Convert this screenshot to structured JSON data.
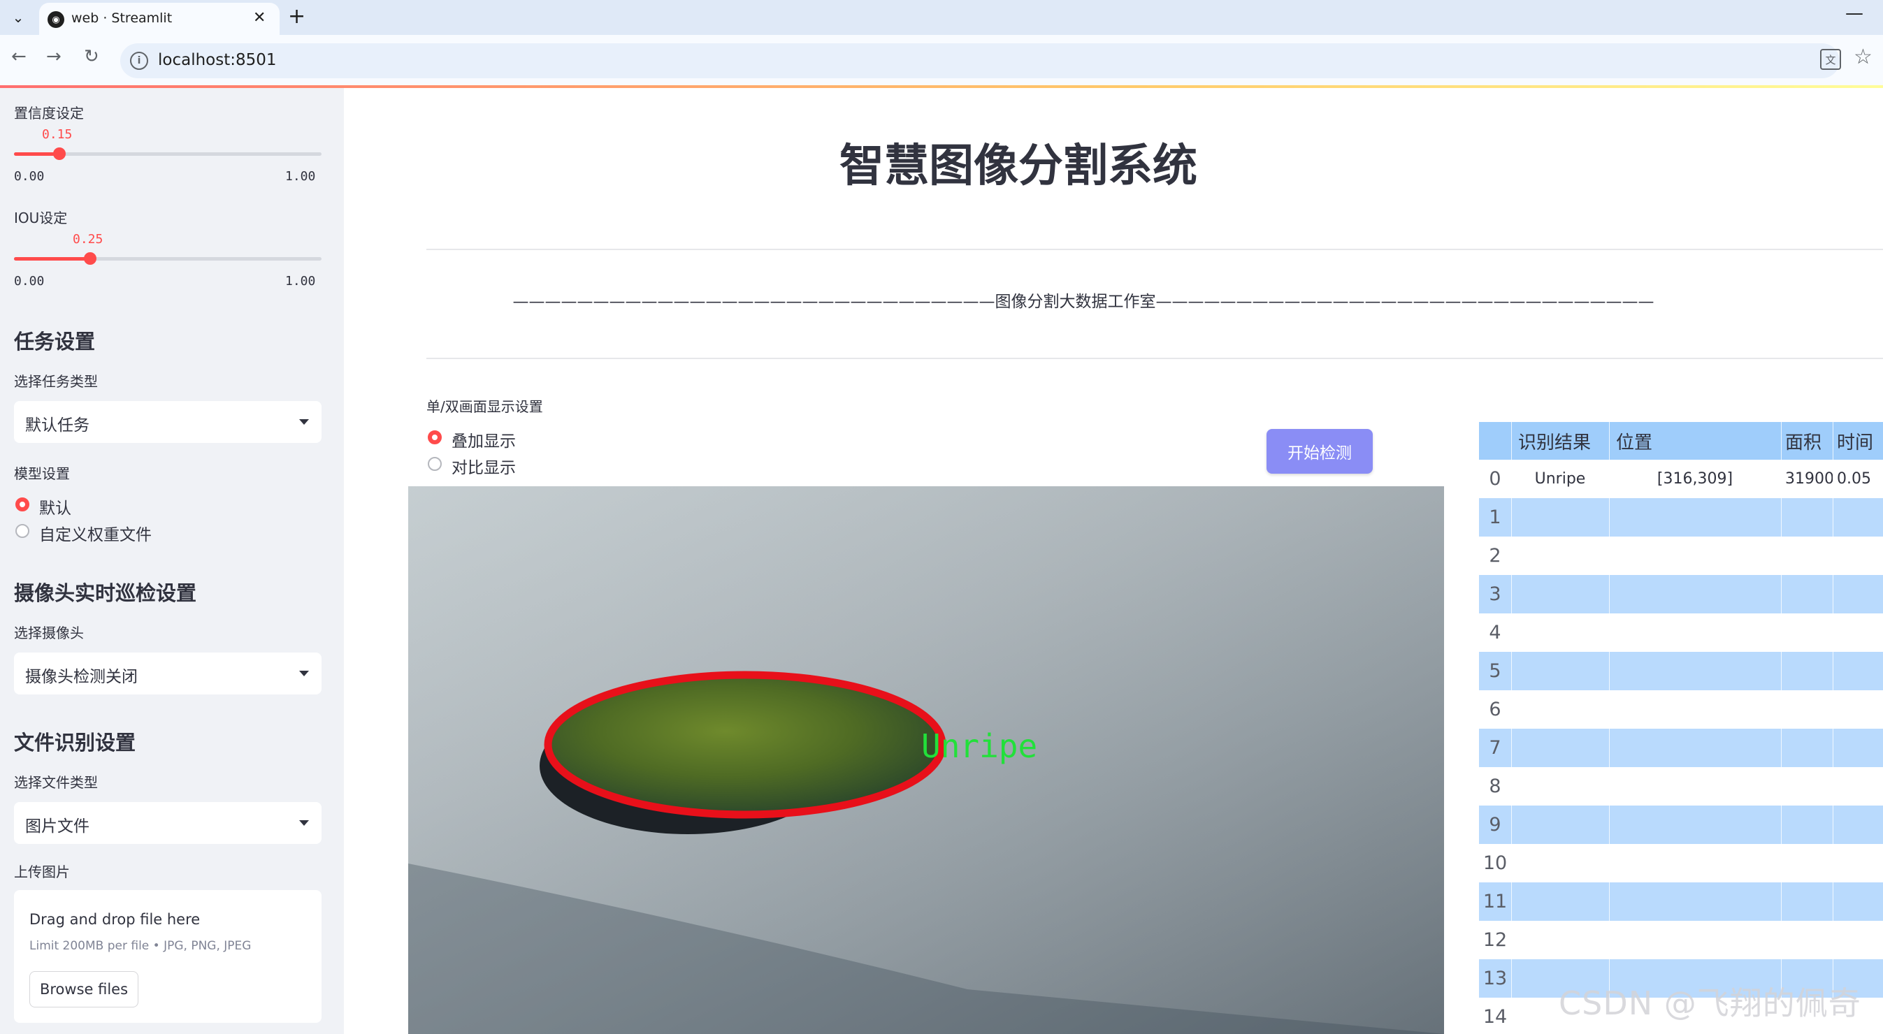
{
  "browser": {
    "tab_title": "web · Streamlit",
    "url": "localhost:8501"
  },
  "sidebar": {
    "confidence": {
      "label": "置信度设定",
      "value": "0.15",
      "min": "0.00",
      "max": "1.00",
      "fraction": 0.15
    },
    "iou": {
      "label": "IOU设定",
      "value": "0.25",
      "min": "0.00",
      "max": "1.00",
      "fraction": 0.25
    },
    "task_heading": "任务设置",
    "task_type_label": "选择任务类型",
    "task_type_value": "默认任务",
    "model_label": "模型设置",
    "model_options": [
      "默认",
      "自定义权重文件"
    ],
    "model_selected": 0,
    "camera_heading": "摄像头实时巡检设置",
    "camera_label": "选择摄像头",
    "camera_value": "摄像头检测关闭",
    "file_heading": "文件识别设置",
    "file_type_label": "选择文件类型",
    "file_type_value": "图片文件",
    "upload_label": "上传图片",
    "upload_drop": "Drag and drop file here",
    "upload_limit": "Limit 200MB per file • JPG, PNG, JPEG",
    "browse_label": "Browse files"
  },
  "main": {
    "title": "智慧图像分割系统",
    "dash_banner": "——————————————————————————————图像分割大数据工作室———————————————————————————————",
    "display_label": "单/双画面显示设置",
    "display_options": [
      "叠加显示",
      "对比显示"
    ],
    "display_selected": 0,
    "start_button": "开始检测",
    "detection_label": "Unripe"
  },
  "results_table": {
    "columns": [
      "识别结果",
      "位置",
      "面积",
      "时间"
    ],
    "rows": [
      {
        "index": "0",
        "result": "Unripe",
        "position": "[316,309]",
        "area": "31900",
        "time": "0.05"
      },
      {
        "index": "1"
      },
      {
        "index": "2"
      },
      {
        "index": "3"
      },
      {
        "index": "4"
      },
      {
        "index": "5"
      },
      {
        "index": "6"
      },
      {
        "index": "7"
      },
      {
        "index": "8"
      },
      {
        "index": "9"
      },
      {
        "index": "10"
      },
      {
        "index": "11"
      },
      {
        "index": "12"
      },
      {
        "index": "13"
      },
      {
        "index": "14"
      }
    ]
  },
  "watermark": "CSDN @飞翔的佩奇",
  "colors": {
    "accent": "#ff4b4b",
    "sidebar_bg": "#f0f2f6",
    "table_header": "#9fcdfb",
    "table_stripe": "#b9dafd",
    "start_button": "#8a8df5",
    "mask_outline": "#e8101a",
    "label_text": "#22e03a"
  }
}
